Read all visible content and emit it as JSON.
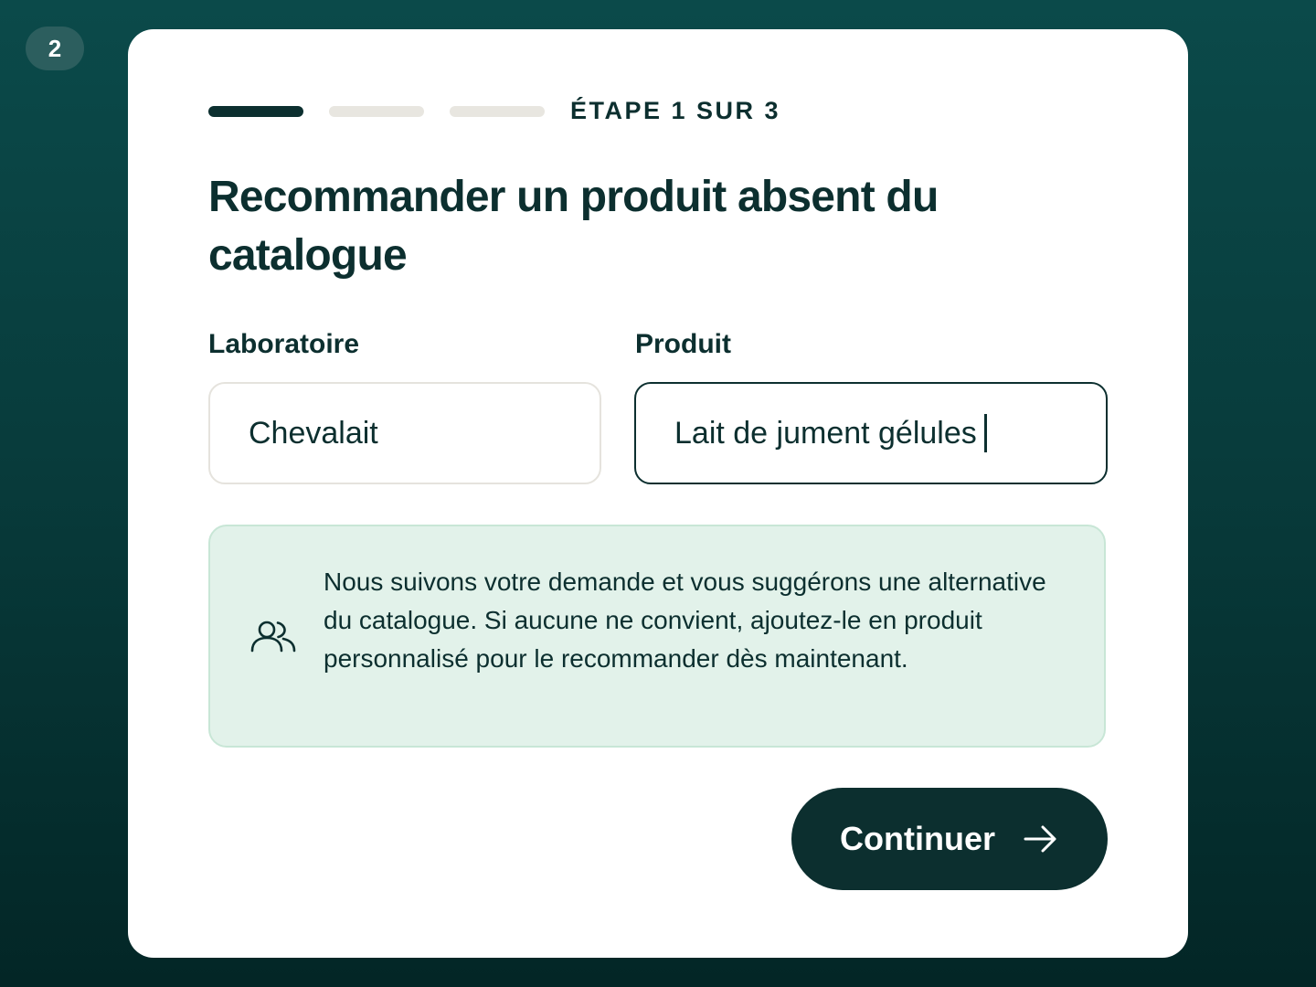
{
  "step_badge": "2",
  "progress": {
    "label": "ÉTAPE 1 SUR 3",
    "current_step": 1,
    "total_steps": 3
  },
  "title": "Recommander un produit absent du catalogue",
  "form": {
    "laboratoire": {
      "label": "Laboratoire",
      "value": "Chevalait"
    },
    "produit": {
      "label": "Produit",
      "value": "Lait de jument gélules"
    }
  },
  "info": {
    "icon": "users-icon",
    "text": "Nous suivons votre demande et vous suggérons une alternative du catalogue. Si aucune ne convient, ajoutez-le en produit personnalisé pour le recommander dès maintenant."
  },
  "continue_button": {
    "label": "Continuer",
    "icon": "arrow-right-icon"
  },
  "colors": {
    "primary": "#0c2f2f",
    "background": "#0b4a4a",
    "info_background": "#e2f2ea",
    "progress_inactive": "#e8e6e0"
  }
}
